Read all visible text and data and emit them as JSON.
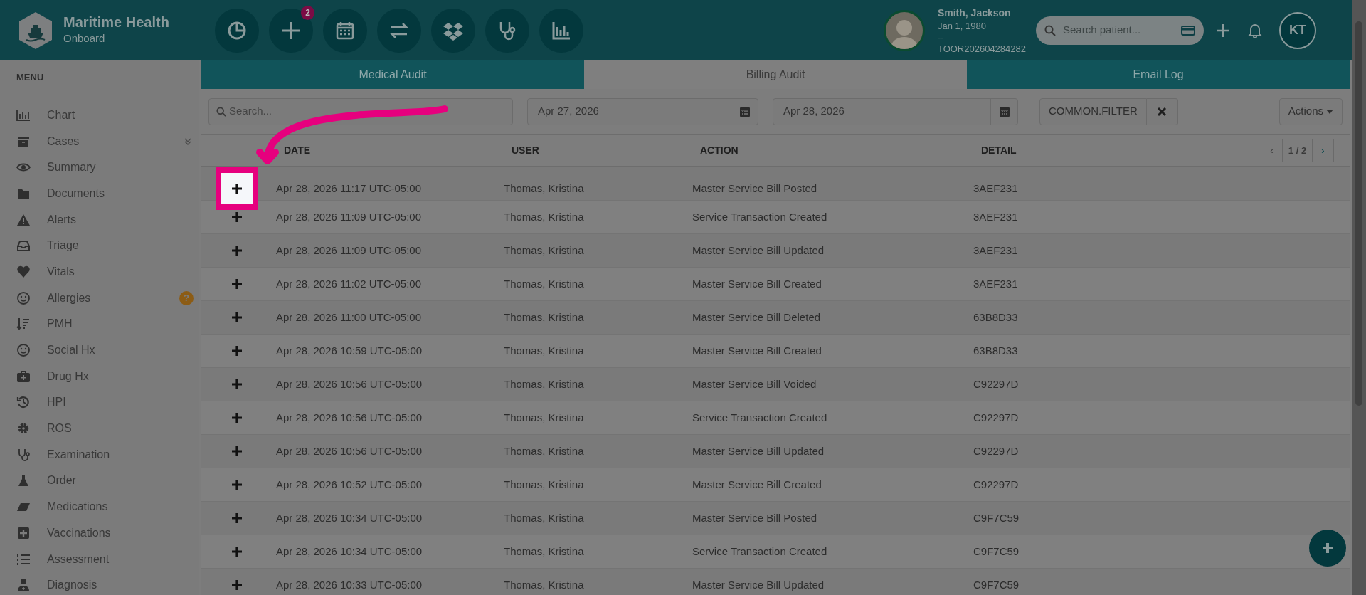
{
  "brand": {
    "title": "Maritime Health",
    "subtitle": "Onboard"
  },
  "toolbar": [
    {
      "kind": "pie"
    },
    {
      "kind": "add",
      "badge": "2"
    },
    {
      "kind": "calendar"
    },
    {
      "kind": "swap"
    },
    {
      "kind": "dropbox"
    },
    {
      "kind": "stethoscope"
    },
    {
      "kind": "bars"
    }
  ],
  "patient": {
    "name": "Smith, Jackson",
    "dob": "Jan 1, 1980",
    "line": "--",
    "id": "TOOR202604284282"
  },
  "patient_search": {
    "placeholder": "Search patient..."
  },
  "user_initials": "KT",
  "menu_title": "MENU",
  "sidebar": {
    "items": [
      {
        "label": "Chart",
        "expandable": false
      },
      {
        "label": "Cases",
        "expandable": true
      },
      {
        "label": "Summary",
        "expandable": false
      },
      {
        "label": "Documents",
        "expandable": false
      },
      {
        "label": "Alerts",
        "expandable": false
      },
      {
        "label": "Triage",
        "expandable": false
      },
      {
        "label": "Vitals",
        "expandable": false
      },
      {
        "label": "Allergies",
        "expandable": false,
        "badge": "?"
      },
      {
        "label": "PMH",
        "expandable": false
      },
      {
        "label": "Social Hx",
        "expandable": false
      },
      {
        "label": "Drug Hx",
        "expandable": false
      },
      {
        "label": "HPI",
        "expandable": false
      },
      {
        "label": "ROS",
        "expandable": false
      },
      {
        "label": "Examination",
        "expandable": false
      },
      {
        "label": "Order",
        "expandable": false
      },
      {
        "label": "Medications",
        "expandable": false
      },
      {
        "label": "Vaccinations",
        "expandable": false
      },
      {
        "label": "Assessment",
        "expandable": false
      },
      {
        "label": "Diagnosis",
        "expandable": false
      }
    ]
  },
  "tabs": [
    {
      "label": "Medical Audit",
      "selected": false
    },
    {
      "label": "Billing Audit",
      "selected": true
    },
    {
      "label": "Email Log",
      "selected": false
    }
  ],
  "filters": {
    "search_placeholder": "Search...",
    "date_from": "Apr 27, 2026",
    "date_to": "Apr 28, 2026",
    "filter_label": "COMMON.FILTER",
    "actions_label": "Actions"
  },
  "table": {
    "columns": [
      "DATE",
      "USER",
      "ACTION",
      "DETAIL"
    ],
    "pager": "1 / 2",
    "pager_prev": "‹",
    "pager_next": "›",
    "rows": [
      {
        "date": "Apr 28, 2026 11:17 UTC-05:00",
        "user": "Thomas, Kristina",
        "action": "Master Service Bill Posted",
        "detail": "3AEF231",
        "highlighted": true
      },
      {
        "date": "Apr 28, 2026 11:09 UTC-05:00",
        "user": "Thomas, Kristina",
        "action": "Service Transaction Created",
        "detail": "3AEF231",
        "highlighted": false
      },
      {
        "date": "Apr 28, 2026 11:09 UTC-05:00",
        "user": "Thomas, Kristina",
        "action": "Master Service Bill Updated",
        "detail": "3AEF231",
        "highlighted": false
      },
      {
        "date": "Apr 28, 2026 11:02 UTC-05:00",
        "user": "Thomas, Kristina",
        "action": "Master Service Bill Created",
        "detail": "3AEF231",
        "highlighted": false
      },
      {
        "date": "Apr 28, 2026 11:00 UTC-05:00",
        "user": "Thomas, Kristina",
        "action": "Master Service Bill Deleted",
        "detail": "63B8D33",
        "highlighted": false
      },
      {
        "date": "Apr 28, 2026 10:59 UTC-05:00",
        "user": "Thomas, Kristina",
        "action": "Master Service Bill Created",
        "detail": "63B8D33",
        "highlighted": false
      },
      {
        "date": "Apr 28, 2026 10:56 UTC-05:00",
        "user": "Thomas, Kristina",
        "action": "Master Service Bill Voided",
        "detail": "C92297D",
        "highlighted": false
      },
      {
        "date": "Apr 28, 2026 10:56 UTC-05:00",
        "user": "Thomas, Kristina",
        "action": "Service Transaction Created",
        "detail": "C92297D",
        "highlighted": false
      },
      {
        "date": "Apr 28, 2026 10:56 UTC-05:00",
        "user": "Thomas, Kristina",
        "action": "Master Service Bill Updated",
        "detail": "C92297D",
        "highlighted": false
      },
      {
        "date": "Apr 28, 2026 10:52 UTC-05:00",
        "user": "Thomas, Kristina",
        "action": "Master Service Bill Created",
        "detail": "C92297D",
        "highlighted": false
      },
      {
        "date": "Apr 28, 2026 10:34 UTC-05:00",
        "user": "Thomas, Kristina",
        "action": "Master Service Bill Posted",
        "detail": "C9F7C59",
        "highlighted": false
      },
      {
        "date": "Apr 28, 2026 10:34 UTC-05:00",
        "user": "Thomas, Kristina",
        "action": "Service Transaction Created",
        "detail": "C9F7C59",
        "highlighted": false
      },
      {
        "date": "Apr 28, 2026 10:33 UTC-05:00",
        "user": "Thomas, Kristina",
        "action": "Master Service Bill Updated",
        "detail": "C9F7C59",
        "highlighted": false
      }
    ]
  }
}
